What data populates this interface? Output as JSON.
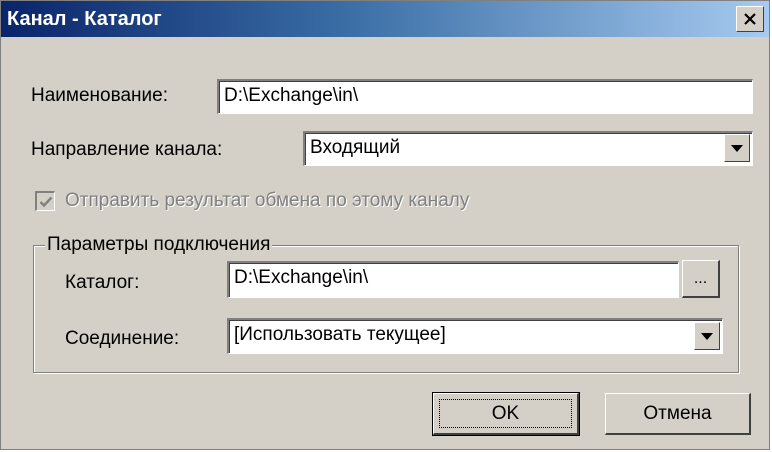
{
  "window": {
    "title": "Канал - Каталог"
  },
  "form": {
    "name_label": "Наименование:",
    "name_value": "D:\\Exchange\\in\\",
    "direction_label": "Направление канала:",
    "direction_value": "Входящий",
    "send_result_label": "Отправить результат обмена по этому каналу",
    "send_result_checked": true,
    "send_result_enabled": false
  },
  "connection_group": {
    "title": "Параметры подключения",
    "catalog_label": "Каталог:",
    "catalog_value": "D:\\Exchange\\in\\",
    "browse_label": "...",
    "connection_label": "Соединение:",
    "connection_value": "[Использовать текущее]"
  },
  "buttons": {
    "ok_label": "OK",
    "cancel_label": "Отмена"
  },
  "icons": {
    "close": "close-icon",
    "dropdown": "chevron-down-icon",
    "check": "check-icon"
  }
}
